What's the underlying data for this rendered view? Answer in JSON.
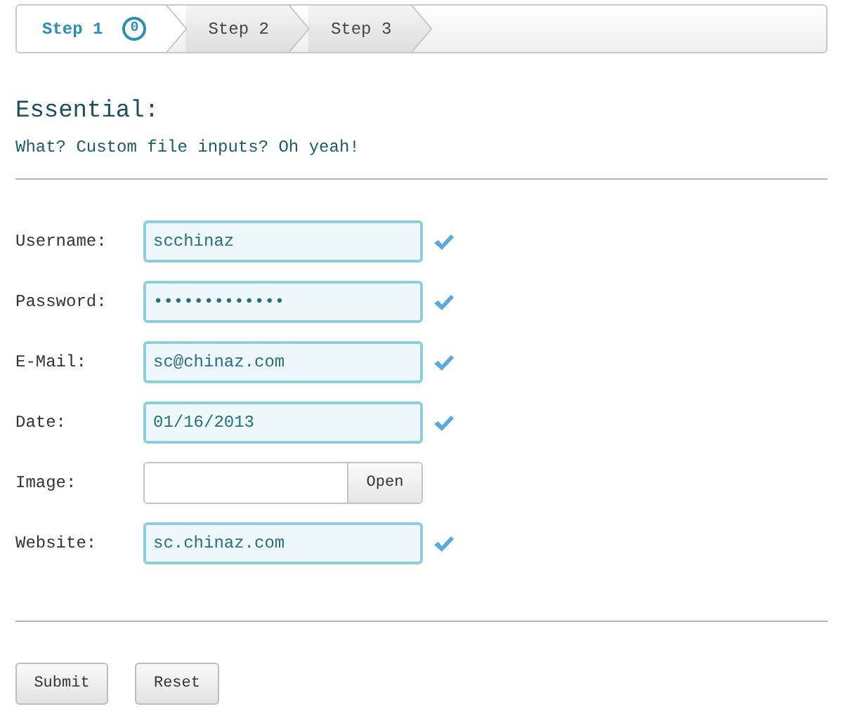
{
  "steps": [
    {
      "label": "Step 1",
      "badge": "0",
      "selected": true
    },
    {
      "label": "Step 2",
      "selected": false
    },
    {
      "label": "Step 3",
      "selected": false
    }
  ],
  "section": {
    "title": "Essential:",
    "subtitle": "What? Custom file inputs? Oh yeah!"
  },
  "fields": [
    {
      "kind": "text",
      "label": "Username:",
      "value": "scchinaz",
      "valid": true
    },
    {
      "kind": "text",
      "label": "Password:",
      "value": "•••••••••••••",
      "valid": true
    },
    {
      "kind": "text",
      "label": "E-Mail:",
      "value": "sc@chinaz.com",
      "valid": true
    },
    {
      "kind": "text",
      "label": "Date:",
      "value": "01/16/2013",
      "valid": true
    },
    {
      "kind": "file",
      "label": "Image:",
      "button": "Open",
      "valid": false
    },
    {
      "kind": "text",
      "label": "Website:",
      "value": "sc.chinaz.com",
      "valid": true
    }
  ],
  "buttons": [
    "Submit",
    "Reset"
  ]
}
